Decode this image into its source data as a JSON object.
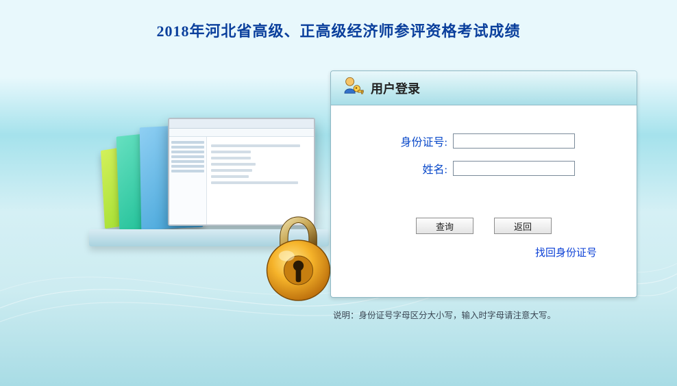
{
  "page": {
    "title": "2018年河北省高级、正高级经济师参评资格考试成绩"
  },
  "panel": {
    "title": "用户登录",
    "icon_name": "user-key"
  },
  "form": {
    "id_label": "身份证号:",
    "id_value": "",
    "name_label": "姓名:",
    "name_value": ""
  },
  "buttons": {
    "query_label": "查询",
    "back_label": "返回"
  },
  "links": {
    "recover_label": "找回身份证号"
  },
  "note": {
    "text": "说明：身份证号字母区分大小写，输入时字母请注意大写。"
  }
}
